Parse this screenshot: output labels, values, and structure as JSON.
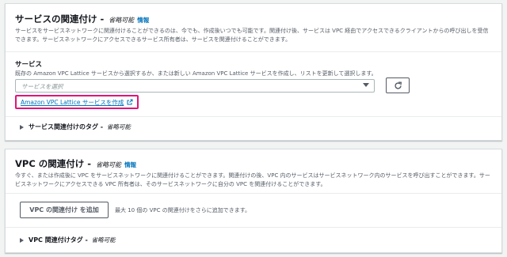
{
  "service_section": {
    "title": "サービスの関連付け - ",
    "optional": "省略可能",
    "info": "情報",
    "desc_line1": "サービスをサービスネットワークに関連付けることができるのは、今でも、作成後いつでも可能です。関連付け後、サービスは VPC 経由でアクセスできるクライアントからの呼び出しを受信できます。サービスネットワークにアクセスできるサービス所有者は、サービスを関連付けることができます。",
    "field_label": "サービス",
    "field_desc": "既存の Amazon VPC Lattice サービスから選択するか、または新しい Amazon VPC Lattice サービスを作成し、リストを更新して選択します。",
    "select_placeholder": "サービスを選択",
    "create_link": "Amazon VPC Lattice サービスを作成",
    "tags_label": "サービス関連付けのタグ - ",
    "tags_optional": "省略可能"
  },
  "vpc_section": {
    "title": "VPC の関連付け - ",
    "optional": "省略可能",
    "info": "情報",
    "desc_line1": "今すぐ、または作成後に VPC をサービスネットワークに関連付けることができます。関連付けの後、VPC 内のサービスはサービスネットワーク内のサービスを呼び出すことができます。サービスネットワークにアクセスできる VPC 所有者は、そのサービスネットワークに自分の VPC を関連付けることができます。",
    "add_button": "VPC の関連付け を追加",
    "add_hint": "最大 10 個の VPC の関連付けをさらに追加できます。",
    "tags_label": "VPC 関連付けタグ - ",
    "tags_optional": "省略可能"
  },
  "colors": {
    "link": "#0073bb",
    "highlight": "#e0157a",
    "background": "#f2f3f3"
  },
  "icons": [
    "refresh-icon",
    "external-link-icon",
    "caret-right-icon",
    "caret-down-icon"
  ]
}
